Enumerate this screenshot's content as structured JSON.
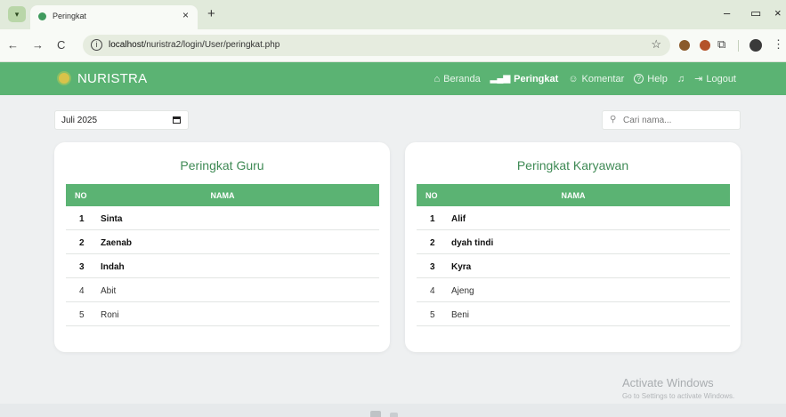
{
  "browser": {
    "tab_title": "Peringkat",
    "tab_close": "×",
    "new_tab": "+",
    "minimize": "–",
    "maximize": "▭",
    "close": "×",
    "back": "←",
    "forward": "→",
    "reload": "C",
    "url_host": "localhost",
    "url_path": "/nuristra2/login/User/peringkat.php",
    "star": "☆",
    "puzzle": "⧉",
    "kebab": "⋮"
  },
  "app": {
    "brand": "NURISTRA",
    "nav": [
      {
        "icon": "⌂",
        "label": "Beranda"
      },
      {
        "icon": "📶",
        "label": "Peringkat"
      },
      {
        "icon": "☺",
        "label": "Komentar"
      },
      {
        "icon": "?",
        "label": "Help"
      },
      {
        "icon": "🔔",
        "label": ""
      },
      {
        "icon": "⇥",
        "label": "Logout"
      }
    ],
    "active_nav": "Peringkat",
    "accent_color": "#5bb373"
  },
  "filters": {
    "month": "Juli 2025",
    "search_placeholder": "Cari nama..."
  },
  "guru": {
    "title": "Peringkat Guru",
    "col_no": "NO",
    "col_nama": "NAMA",
    "rows": [
      {
        "no": "1",
        "nama": "Sinta"
      },
      {
        "no": "2",
        "nama": "Zaenab"
      },
      {
        "no": "3",
        "nama": "Indah"
      },
      {
        "no": "4",
        "nama": "Abit"
      },
      {
        "no": "5",
        "nama": "Roni"
      }
    ]
  },
  "karyawan": {
    "title": "Peringkat Karyawan",
    "col_no": "NO",
    "col_nama": "NAMA",
    "rows": [
      {
        "no": "1",
        "nama": "Alif"
      },
      {
        "no": "2",
        "nama": "dyah tindi"
      },
      {
        "no": "3",
        "nama": "Kyra"
      },
      {
        "no": "4",
        "nama": "Ajeng"
      },
      {
        "no": "5",
        "nama": "Beni"
      }
    ]
  },
  "watermark": {
    "line1": "Activate Windows",
    "line2": "Go to Settings to activate Windows."
  }
}
